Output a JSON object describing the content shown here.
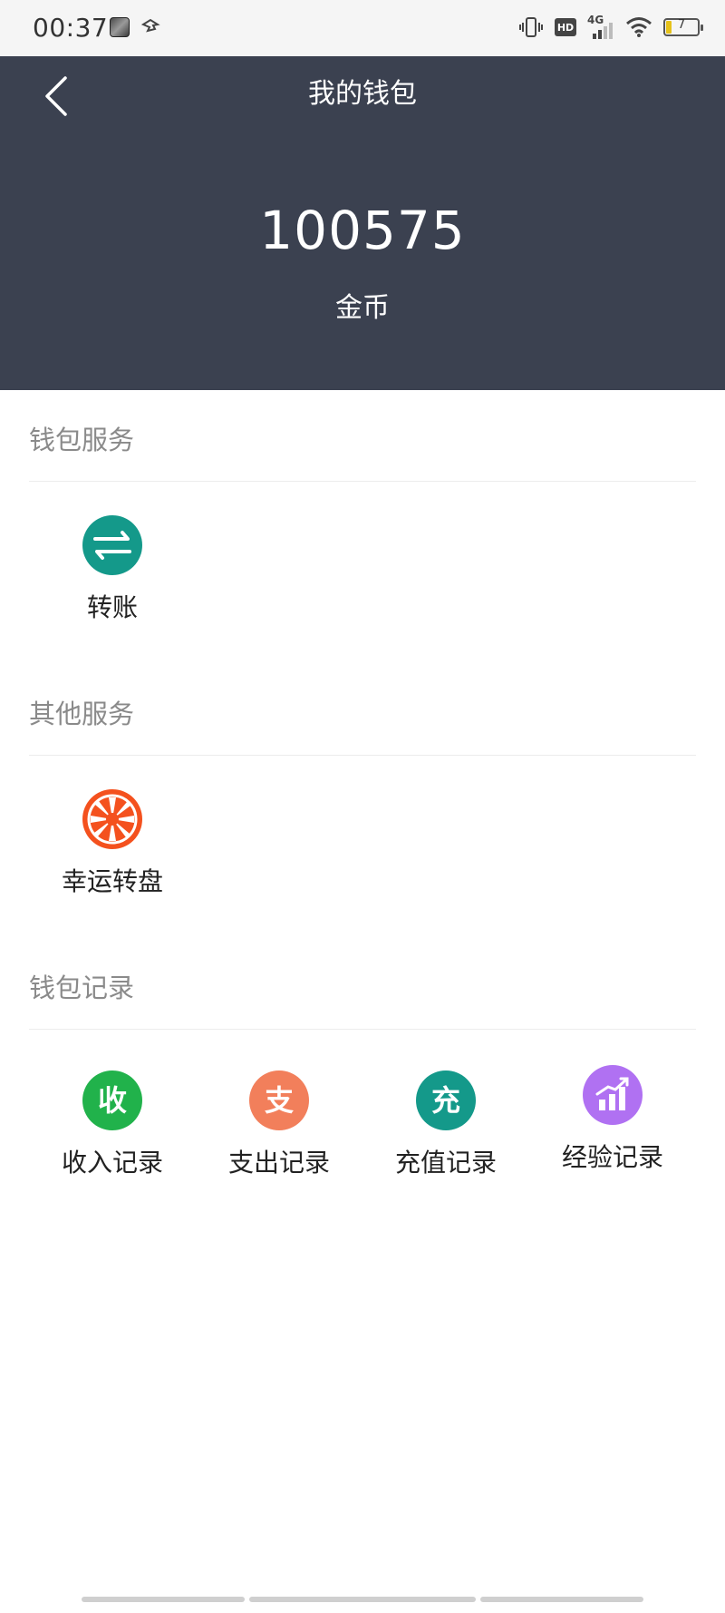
{
  "status_bar": {
    "time": "00:37",
    "hd": "HD",
    "network": "4G",
    "battery_level": "7"
  },
  "header": {
    "title": "我的钱包",
    "balance": "100575",
    "balance_unit": "金币",
    "background_color": "#3b4150"
  },
  "sections": [
    {
      "title": "钱包服务",
      "items": [
        {
          "label": "转账",
          "icon": "transfer-icon",
          "color": "#14998a"
        }
      ]
    },
    {
      "title": "其他服务",
      "items": [
        {
          "label": "幸运转盘",
          "icon": "lucky-wheel-icon",
          "color": "#f4511e"
        }
      ]
    },
    {
      "title": "钱包记录",
      "items": [
        {
          "label": "收入记录",
          "icon_text": "收",
          "icon": "income-icon",
          "color": "#21b24b"
        },
        {
          "label": "支出记录",
          "icon_text": "支",
          "icon": "expense-icon",
          "color": "#f27f5b"
        },
        {
          "label": "充值记录",
          "icon_text": "充",
          "icon": "recharge-icon",
          "color": "#14998a"
        },
        {
          "label": "经验记录",
          "icon": "experience-chart-icon",
          "color": "#b071f2"
        }
      ]
    }
  ]
}
